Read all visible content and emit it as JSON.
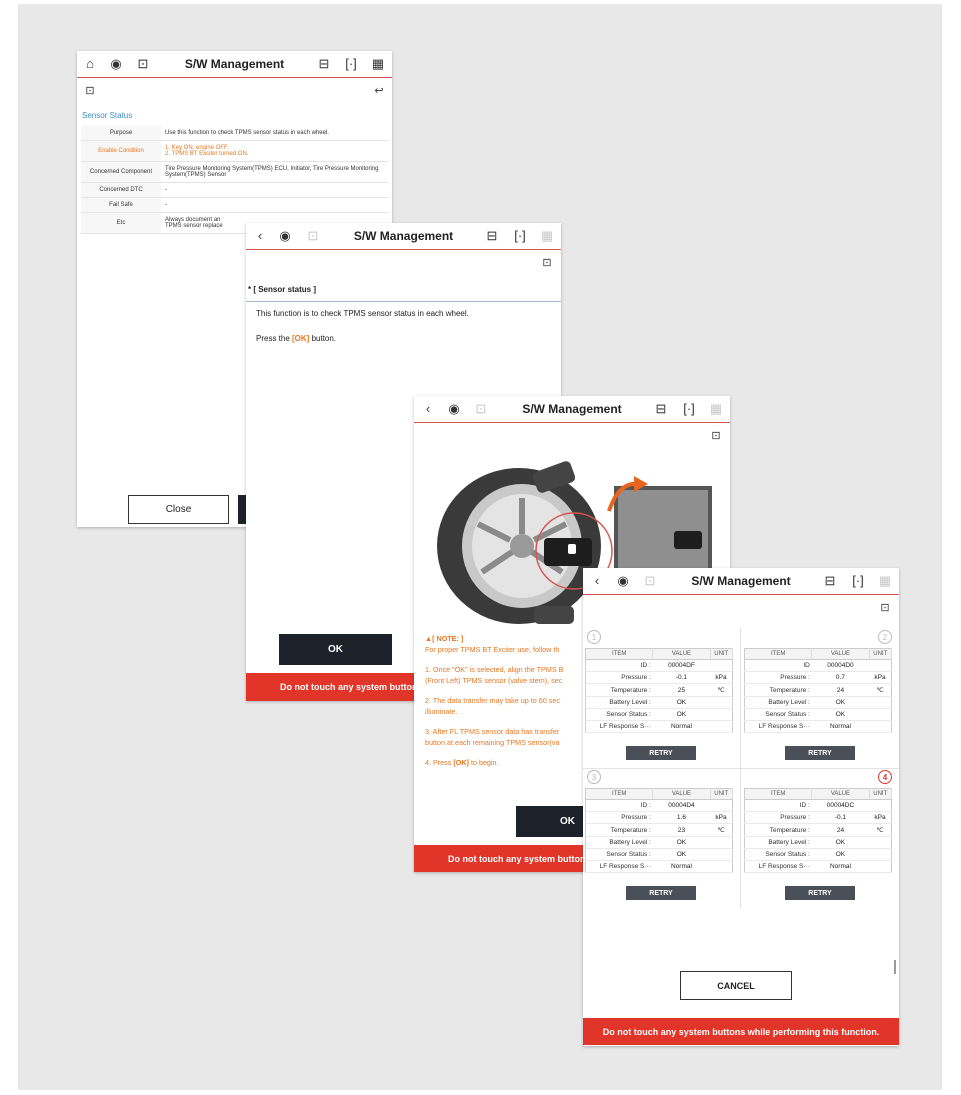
{
  "colors": {
    "accent_red": "#e1352a",
    "orange": "#e87722",
    "dark_button": "#1d2129",
    "link_blue": "#3b8fc6"
  },
  "screen1": {
    "title": "S/W Management",
    "section_title": "Sensor Status",
    "rows": [
      {
        "label": "Purpose",
        "value": "Use this function to check TPMS sensor status in each wheel."
      },
      {
        "label": "Enable Condition",
        "value": "1. Key ON, engine OFF.\n2. TPMS BT Exciter turned ON."
      },
      {
        "label": "Concerned Component",
        "value": "Tire Pressure Monitoring System(TPMS) ECU, Initiator, Tire Pressure Monitoring System(TPMS) Sensor"
      },
      {
        "label": "Concerned DTC",
        "value": "-"
      },
      {
        "label": "Fail Safe",
        "value": "-"
      },
      {
        "label": "Etc",
        "value": "Always document an\nTPMS sensor replace"
      }
    ],
    "close_label": "Close"
  },
  "screen2": {
    "title": "S/W Management",
    "heading": "* [ Sensor status ]",
    "line1": "This function is to check TPMS sensor status in each wheel.",
    "line2_pre": "Press the ",
    "line2_key": "[OK]",
    "line2_post": " button.",
    "ok_label": "OK",
    "warning": "Do not touch any system buttons w"
  },
  "screen3": {
    "title": "S/W Management",
    "note_title": "[ NOTE: ]",
    "note_intro": "For proper TPMS BT Exciter use, follow th",
    "step1": "1. Once \"OK\" is selected, align the TPMS B\n(Front Left) TPMS sensor (valve stem), sec",
    "step2": "2. The data transfer may take up to 60 sec\nilluminate.",
    "step3": "3. After FL TPMS sensor data has transfer\nbutton at each remaining TPMS sensor(va",
    "step4_pre": "4. Press ",
    "step4_key": "[OK]",
    "step4_post": " to begin.",
    "ok_label": "OK",
    "warning": "Do not touch any system buttons w"
  },
  "screen4": {
    "title": "S/W Management",
    "headers": [
      "ITEM",
      "VALUE",
      "UNIT"
    ],
    "retry_label": "RETRY",
    "cancel_label": "CANCEL",
    "warning": "Do not touch any system buttons while performing this function.",
    "wheels": [
      {
        "num": "1",
        "rows": [
          [
            "ID :",
            "00004DF",
            ""
          ],
          [
            "Pressure :",
            "-0.1",
            "kPa"
          ],
          [
            "Temperature :",
            "25",
            "℃"
          ],
          [
            "Battery Level :",
            "OK",
            ""
          ],
          [
            "Sensor Status :",
            "OK",
            ""
          ],
          [
            "LF Response S···",
            "Normal",
            ""
          ]
        ]
      },
      {
        "num": "2",
        "rows": [
          [
            "ID",
            "00004D0",
            ""
          ],
          [
            "Pressure :",
            "0.7",
            "kPa"
          ],
          [
            "Temperature :",
            "24",
            "℃"
          ],
          [
            "Battery Level :",
            "OK",
            ""
          ],
          [
            "Sensor Status :",
            "OK",
            ""
          ],
          [
            "LF Response S···",
            "Normal",
            ""
          ]
        ]
      },
      {
        "num": "3",
        "rows": [
          [
            "ID :",
            "00004D4",
            ""
          ],
          [
            "Pressure :",
            "1.6",
            "kPa"
          ],
          [
            "Temperature :",
            "23",
            "℃"
          ],
          [
            "Battery Level :",
            "OK",
            ""
          ],
          [
            "Sensor Status :",
            "OK",
            ""
          ],
          [
            "LF Response S···",
            "Normal",
            ""
          ]
        ]
      },
      {
        "num": "4",
        "rows": [
          [
            "ID :",
            "00004DC",
            ""
          ],
          [
            "Pressure :",
            "-0.1",
            "kPa"
          ],
          [
            "Temperature :",
            "24",
            "℃"
          ],
          [
            "Battery Level :",
            "OK",
            ""
          ],
          [
            "Sensor Status :",
            "OK",
            ""
          ],
          [
            "LF Response S···",
            "Normal",
            ""
          ]
        ]
      }
    ]
  }
}
